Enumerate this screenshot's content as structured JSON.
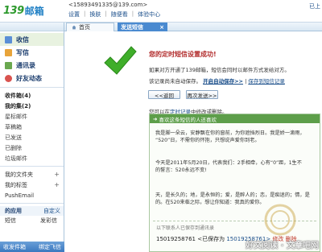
{
  "brand": {
    "num": "139",
    "word": "邮箱"
  },
  "header": {
    "account": "<15893491335@139.com>",
    "links": [
      "设置",
      "换肤",
      "随便看",
      "体验中心"
    ],
    "right": "已上"
  },
  "tabs": {
    "home": "首页",
    "active": "发送短信",
    "close": "×"
  },
  "sidebar": {
    "nav": [
      {
        "label": "收信"
      },
      {
        "label": "写信"
      },
      {
        "label": "通讯录"
      },
      {
        "label": "好友动态"
      }
    ],
    "folders": {
      "inbox": "收件箱(4)",
      "my_collection": "我的集(2)",
      "starred": "星标邮件",
      "drafts": "草稿箱",
      "sent": "已发送",
      "deleted": "已删除",
      "spam": "垃圾邮件",
      "my_folders": "我的文件夹",
      "my_tags": "我的标签",
      "pushemail": "PushEmail"
    },
    "apps": {
      "head": "的应用",
      "custom": "自定义",
      "row1_left": "短信",
      "row1_right": "发彩信"
    },
    "bottom": {
      "left": "收发件箱",
      "right": "绑定飞信"
    }
  },
  "main": {
    "success_title": "您的定时短信设置成功!",
    "desc1": "如果对方开通了139邮箱，短信会同时以邮件方式发给对方。",
    "desc2_prefix": "该记录尚未自动保存。",
    "desc2_link1": "开启自动保存>>",
    "desc2_link2": "保存到短信记录",
    "btn_back": "<<返回",
    "btn_again": "再次发送>>",
    "record_prefix": "您可以在",
    "record_link": "定时记录",
    "record_suffix": "中修改或删除。",
    "preview_head": "喜欢这条短信的人还喜欢",
    "para1": [
      "我是脚一朵云，安静飘在你的窗前，为你遮挡烈日。我是娇一滴雨，",
      "“520”日，不需你的怀抱，只想说声爱你到老。"
    ],
    "para2": [
      "今天是2011年5月20日，代表我们：2手相牵，心有“0”距，1生不",
      "的誓言：520永远不变!"
    ],
    "para3": [
      "天，是长久的；地，是永恒的；爱，是醉人的；恋，是痴迷的；情，是",
      "的。在520来临之际，想让你知道：我真的爱你。"
    ],
    "foot_note": "以下联系人已保存到通讯录",
    "sender_num": "15019258761",
    "sender_mid": "<已保存为",
    "sender_name": "15019258761>",
    "sender_tail": "修改 删除"
  },
  "watermark": "好文阅读 · 文章吧网"
}
